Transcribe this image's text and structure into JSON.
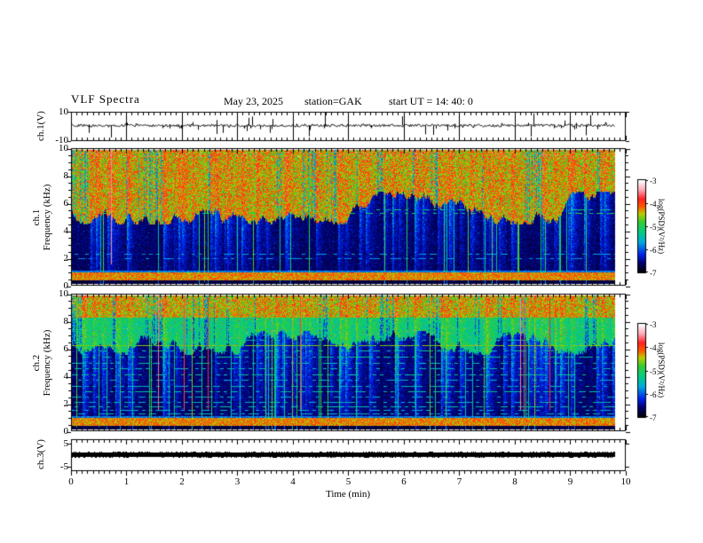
{
  "title": "VLF Spectra",
  "header": {
    "date": "May 23, 2025",
    "station": "station=GAK",
    "start_ut": "start UT =  14: 40: 0"
  },
  "xaxis": {
    "label": "Time  (min)",
    "ticks": [
      "0",
      "1",
      "2",
      "3",
      "4",
      "5",
      "6",
      "7",
      "8",
      "9",
      "10"
    ]
  },
  "panels": {
    "ch1_wave": {
      "ylabel": "ch.1(V)",
      "ytop": "10",
      "ybottom": "-10"
    },
    "spec1": {
      "ylabel_line1": "ch.1",
      "ylabel_line2": "Frequency  (kHz)",
      "yticks": [
        "10",
        "8",
        "6",
        "4",
        "2",
        "0"
      ]
    },
    "spec2": {
      "ylabel_line1": "ch.2",
      "ylabel_line2": "Frequency  (kHz)",
      "yticks": [
        "10",
        "8",
        "6",
        "4",
        "2",
        "0"
      ]
    },
    "ch3_wave": {
      "ylabel": "ch.3(V)",
      "ytop": "5",
      "ybottom": "-5"
    }
  },
  "colorbars": [
    {
      "label": "log(PSD)(V²/Hz)",
      "ticks": [
        "-3",
        "-4",
        "-5",
        "-6",
        "-7"
      ]
    },
    {
      "label": "log(PSD)(V²/Hz)",
      "ticks": [
        "-3",
        "-4",
        "-5",
        "-6",
        "-7"
      ]
    }
  ],
  "colors": {
    "background": "#ffffff",
    "axis": "#000000",
    "colormap_bottom_to_top": [
      {
        "pos": 0.0,
        "color": "#000000"
      },
      {
        "pos": 0.1,
        "color": "#000066"
      },
      {
        "pos": 0.2,
        "color": "#0022ee"
      },
      {
        "pos": 0.33,
        "color": "#00aadd"
      },
      {
        "pos": 0.43,
        "color": "#00cc88"
      },
      {
        "pos": 0.55,
        "color": "#33cc33"
      },
      {
        "pos": 0.64,
        "color": "#bbcc00"
      },
      {
        "pos": 0.72,
        "color": "#ff5500"
      },
      {
        "pos": 0.8,
        "color": "#ff2222"
      },
      {
        "pos": 0.9,
        "color": "#ffaabb"
      },
      {
        "pos": 1.0,
        "color": "#ffffff"
      }
    ]
  },
  "chart_data": [
    {
      "type": "line",
      "panel": "ch.1 time series",
      "ylabel": "ch.1(V)",
      "y_ticks_V": [
        10,
        -10
      ],
      "x_range_min": [
        0,
        10
      ],
      "data_end_min": 9.8,
      "summary": "Noisy quasi-flat trace near 0 V (about ±1 V) with ~40 impulsive spikes, mostly downward to -3..-8 V, and a pair of large upward spikes (~+9 V) near 5.1 min"
    },
    {
      "type": "heatmap",
      "panel": "ch.1 spectrogram",
      "ylabel": "Frequency (kHz)",
      "y_range_kHz": [
        0,
        10
      ],
      "x_range_min": [
        0,
        9.8
      ],
      "z_label": "log(PSD)(V²/Hz)",
      "z_range": [
        -7,
        -3
      ],
      "features": {
        "hf_curtain_lower_edge_kHz": 5.7,
        "edge_wander_kHz": 1.2,
        "hf_level_log_psd": -4.7,
        "background_level_log_psd": -6.8,
        "vertical_sferic_streaks": "dense thin columns fading toward low frequency",
        "red_specks_above_kHz": 9.4,
        "powerline_harmonic_bands_kHz": [
          0.4,
          0.55,
          0.7,
          0.85
        ],
        "narrow_lines": [
          {
            "f_kHz": 5.3,
            "level": 0.5,
            "duty": 0.5
          },
          {
            "f_kHz": 5.55,
            "level": 0.45,
            "duty": 0.4
          },
          {
            "f_kHz": 2.25,
            "level": 0.32,
            "duty": 0.35
          },
          {
            "f_kHz": 1.9,
            "level": 0.3,
            "duty": 0.3
          }
        ]
      }
    },
    {
      "type": "heatmap",
      "panel": "ch.2 spectrogram",
      "ylabel": "Frequency (kHz)",
      "y_range_kHz": [
        0,
        10
      ],
      "x_range_min": [
        0,
        9.8
      ],
      "z_label": "log(PSD)(V²/Hz)",
      "z_range": [
        -7,
        -3
      ],
      "features": {
        "hf_curtain_lower_edge_kHz": 6.5,
        "edge_wander_kHz": 0.9,
        "cyan_zone_kHz": [
          6.5,
          8.4
        ],
        "green_zone_kHz": [
          8.4,
          10
        ],
        "strong_band_kHz": 6.3,
        "red_vertical_streaks": "occasional thin red/orange full-height columns",
        "powerline_harmonic_bands_kHz": [
          0.4,
          0.55,
          0.7,
          0.85
        ],
        "narrow_lines": [
          {
            "f_kHz": 7.5,
            "level": 0.36,
            "duty": 0.5
          },
          {
            "f_kHz": 7.1,
            "level": 0.34,
            "duty": 0.45
          },
          {
            "f_kHz": 6.7,
            "level": 0.38,
            "duty": 0.5
          },
          {
            "f_kHz": 6.3,
            "level": 0.62,
            "duty": 0.92
          },
          {
            "f_kHz": 5.9,
            "level": 0.4,
            "duty": 0.5
          },
          {
            "f_kHz": 5.45,
            "level": 0.42,
            "duty": 0.55
          },
          {
            "f_kHz": 5.0,
            "level": 0.38,
            "duty": 0.5
          },
          {
            "f_kHz": 4.55,
            "level": 0.36,
            "duty": 0.45
          },
          {
            "f_kHz": 4.1,
            "level": 0.4,
            "duty": 0.5
          },
          {
            "f_kHz": 3.7,
            "level": 0.34,
            "duty": 0.45
          },
          {
            "f_kHz": 3.25,
            "level": 0.36,
            "duty": 0.5
          },
          {
            "f_kHz": 2.85,
            "level": 0.4,
            "duty": 0.5
          },
          {
            "f_kHz": 2.45,
            "level": 0.34,
            "duty": 0.45
          },
          {
            "f_kHz": 2.05,
            "level": 0.36,
            "duty": 0.5
          },
          {
            "f_kHz": 1.75,
            "level": 0.4,
            "duty": 0.55
          },
          {
            "f_kHz": 1.45,
            "level": 0.34,
            "duty": 0.45
          },
          {
            "f_kHz": 1.2,
            "level": 0.36,
            "duty": 0.5
          }
        ]
      }
    },
    {
      "type": "line",
      "panel": "ch.3 time series",
      "ylabel": "ch.3(V)",
      "y_ticks_V": [
        5,
        -5
      ],
      "x_range_min": [
        0,
        10
      ],
      "data_end_min": 9.8,
      "summary": "Saturated flat black band at ~0 V across the entire record"
    }
  ]
}
